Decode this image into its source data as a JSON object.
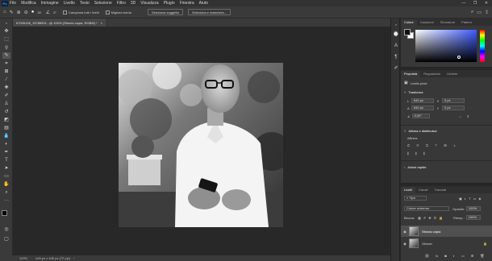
{
  "menubar": {
    "logo": "Ps",
    "items": [
      "File",
      "Modifica",
      "Immagine",
      "Livello",
      "Testo",
      "Selezione",
      "Filtro",
      "3D",
      "Visualizza",
      "Plugin",
      "Finestra",
      "Aiuto"
    ],
    "window_controls": [
      "—",
      "❐",
      "✕"
    ]
  },
  "options": {
    "brush_size": "30",
    "angle": "0°",
    "sample_all_label": "Campiona tutti i livelli",
    "enhance_edge_label": "Migliora bordo",
    "select_subject": "Seleziona soggetto",
    "select_mask": "Seleziona e maschera..."
  },
  "document": {
    "tab_label": "67026106_15786531...@ 100% (Sfondo copia, RGB/8) *",
    "tab_close": "×"
  },
  "status": {
    "zoom": "100%",
    "info": "640 px x 640 px (72 ppi)"
  },
  "color_panel": {
    "tabs": [
      "Colore",
      "Campioni",
      "Sfumature",
      "Pattern"
    ],
    "active_tab": 0
  },
  "properties_panel": {
    "tabs": [
      "Proprietà",
      "Regolazioni",
      "Librerie"
    ],
    "active_tab": 0,
    "layer_kind": "Livello pixel",
    "transform_heading": "Trasforma",
    "w_label": "L",
    "w_value": "640 px",
    "h_label": "A",
    "h_value": "640 px",
    "x_label": "X",
    "x_value": "0 px",
    "y_label": "Y",
    "y_value": "0 px",
    "angle_value": "0,00°",
    "align_heading": "Allinea e distribuisci",
    "align_sub": "Allinea:",
    "quick_actions": "Azioni rapide"
  },
  "layers_panel": {
    "tabs": [
      "Livelli",
      "Canali",
      "Tracciati"
    ],
    "active_tab": 0,
    "filter_kind": "Tipo",
    "blend_mode": "Colore schermo",
    "opacity_label": "Opacità:",
    "opacity_value": "100%",
    "lock_label": "Blocca:",
    "fill_label": "Riemp.:",
    "fill_value": "100%",
    "layers": [
      {
        "name": "Sfondo copia",
        "selected": true
      },
      {
        "name": "Sfondo",
        "selected": false
      }
    ]
  },
  "colors": {
    "accent": "#31a8ff",
    "panel": "#383838",
    "canvas_bg": "#282828"
  }
}
